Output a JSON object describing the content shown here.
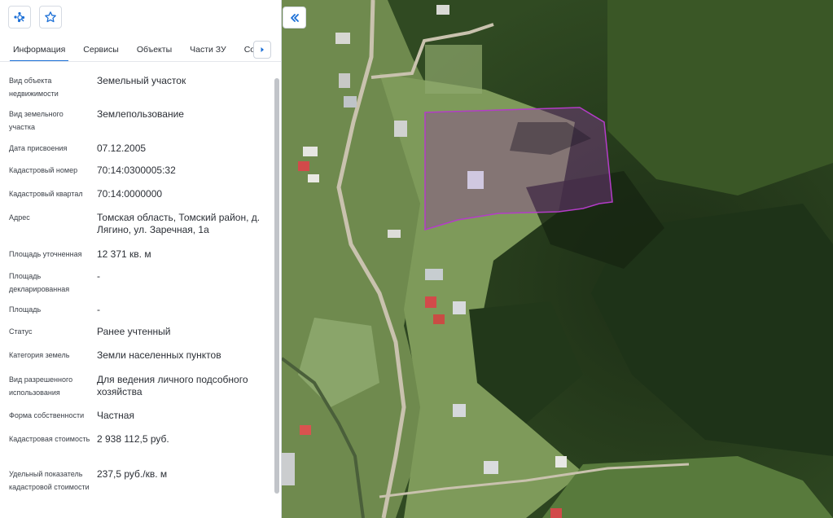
{
  "toolbar": {
    "layers_icon": "layers-search-icon",
    "favorite_icon": "star-icon"
  },
  "tabs": [
    {
      "label": "Информация",
      "active": true
    },
    {
      "label": "Сервисы",
      "active": false
    },
    {
      "label": "Объекты",
      "active": false
    },
    {
      "label": "Части ЗУ",
      "active": false
    },
    {
      "label": "Соста",
      "active": false
    }
  ],
  "info": [
    {
      "label": "Вид объекта недвижимости",
      "value": "Земельный участок"
    },
    {
      "label": "Вид земельного участка",
      "value": "Землепользование"
    },
    {
      "label": "Дата присвоения",
      "value": "07.12.2005"
    },
    {
      "label": "Кадастровый номер",
      "value": "70:14:0300005:32"
    },
    {
      "label": "Кадастровый квартал",
      "value": "70:14:0000000"
    },
    {
      "label": "Адрес",
      "value": "Томская область, Томский район, д. Лягино, ул. Заречная, 1а"
    },
    {
      "label": "Площадь уточненная",
      "value": "12 371 кв. м"
    },
    {
      "label": "Площадь декларированная",
      "value": "-"
    },
    {
      "label": "Площадь",
      "value": "-"
    },
    {
      "label": "Статус",
      "value": "Ранее учтенный"
    },
    {
      "label": "Категория земель",
      "value": "Земли населенных пунктов"
    },
    {
      "label": "Вид разрешенного использования",
      "value": "Для ведения личного подсобного хозяйства"
    },
    {
      "label": "Форма собственности",
      "value": "Частная"
    },
    {
      "label": "Кадастровая стоимость",
      "value": "2 938 112,5 руб."
    },
    {
      "label": "Удельный показатель кадастровой стоимости",
      "value": "237,5 руб./кв. м"
    }
  ],
  "map": {
    "collapse_icon": "double-chevron-left-icon",
    "parcel_color": "#b43cc8",
    "accent": "#1b6fd6"
  }
}
